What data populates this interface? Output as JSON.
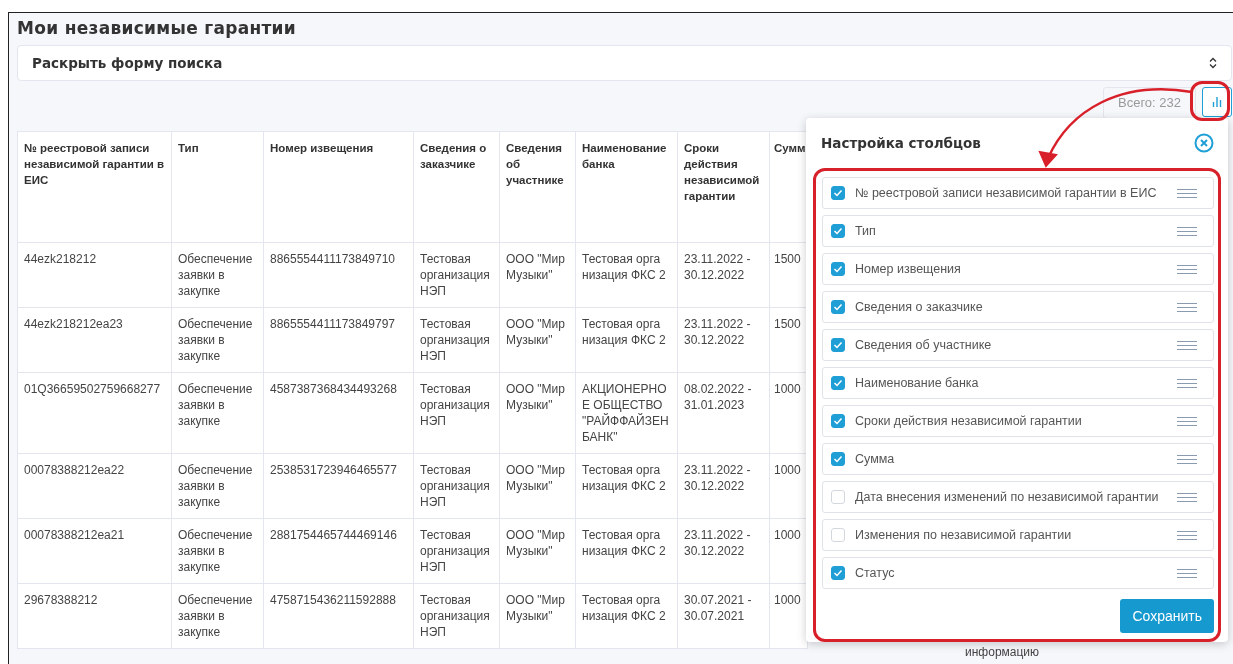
{
  "page": {
    "title": "Мои независимые гарантии"
  },
  "search_toggle": {
    "label": "Раскрыть форму поиска"
  },
  "toolbar": {
    "total": "Всего: 232"
  },
  "table": {
    "columns": [
      "№ реестровой записи независимой гарантии в ЕИС",
      "Тип",
      "Номер извещения",
      "Сведения о заказчике",
      "Сведения об участнике",
      "Наименование банка",
      "Сроки действия независимой гарантии",
      "Сумм"
    ],
    "rows": [
      {
        "cells": [
          "44ezk218212",
          "Обеспечение заявки в закупке",
          "8865554411173849710",
          "Тестовая организация НЭП",
          "ООО \"Мир Музыки\"",
          "Тестовая орга низация ФКС 2",
          "23.11.2022 - 30.12.2022",
          "1500"
        ]
      },
      {
        "cells": [
          "44ezk218212ea23",
          "Обеспечение заявки в закупке",
          "8865554411173849797",
          "Тестовая организация НЭП",
          "ООО \"Мир Музыки\"",
          "Тестовая орга низация ФКС 2",
          "23.11.2022 - 30.12.2022",
          "1500"
        ]
      },
      {
        "cells": [
          "01Q36659502759668277",
          "Обеспечение заявки в закупке",
          "4587387368434493268",
          "Тестовая организация НЭП",
          "ООО \"Мир Музыки\"",
          "АКЦИОНЕРНО Е ОБЩЕСТВО \"РАЙФФАЙЗЕН БАНК\"",
          "08.02.2022 - 31.01.2023",
          "1000"
        ]
      },
      {
        "cells": [
          "00078388212ea22",
          "Обеспечение заявки в закупке",
          "2538531723946465577",
          "Тестовая организация НЭП",
          "ООО \"Мир Музыки\"",
          "Тестовая орга низация ФКС 2",
          "23.11.2022 - 30.12.2022",
          "1000"
        ]
      },
      {
        "cells": [
          "00078388212ea21",
          "Обеспечение заявки в закупке",
          "2881754465744469146",
          "Тестовая организация НЭП",
          "ООО \"Мир Музыки\"",
          "Тестовая орга низация ФКС 2",
          "23.11.2022 - 30.12.2022",
          "1000"
        ]
      },
      {
        "cells": [
          "29678388212",
          "Обеспечение заявки в закупке",
          "4758715436211592888",
          "Тестовая организация НЭП",
          "ООО \"Мир Музыки\"",
          "Тестовая орга низация ФКС 2",
          "30.07.2021 - 30.07.2021",
          "1000"
        ]
      }
    ],
    "column_9_fragment": "информацию"
  },
  "column_settings": {
    "title": "Настройка столбцов",
    "items": [
      {
        "label": "№ реестровой записи независимой гарантии в ЕИС",
        "checked": true
      },
      {
        "label": "Тип",
        "checked": true
      },
      {
        "label": "Номер извещения",
        "checked": true
      },
      {
        "label": "Сведения о заказчике",
        "checked": true
      },
      {
        "label": "Сведения об участнике",
        "checked": true
      },
      {
        "label": "Наименование банка",
        "checked": true
      },
      {
        "label": "Сроки действия независимой гарантии",
        "checked": true
      },
      {
        "label": "Сумма",
        "checked": true
      },
      {
        "label": "Дата внесения изменений по независимой гарантии",
        "checked": false
      },
      {
        "label": "Изменения по независимой гарантии",
        "checked": false
      },
      {
        "label": "Статус",
        "checked": true
      }
    ],
    "save_button": "Сохранить"
  }
}
